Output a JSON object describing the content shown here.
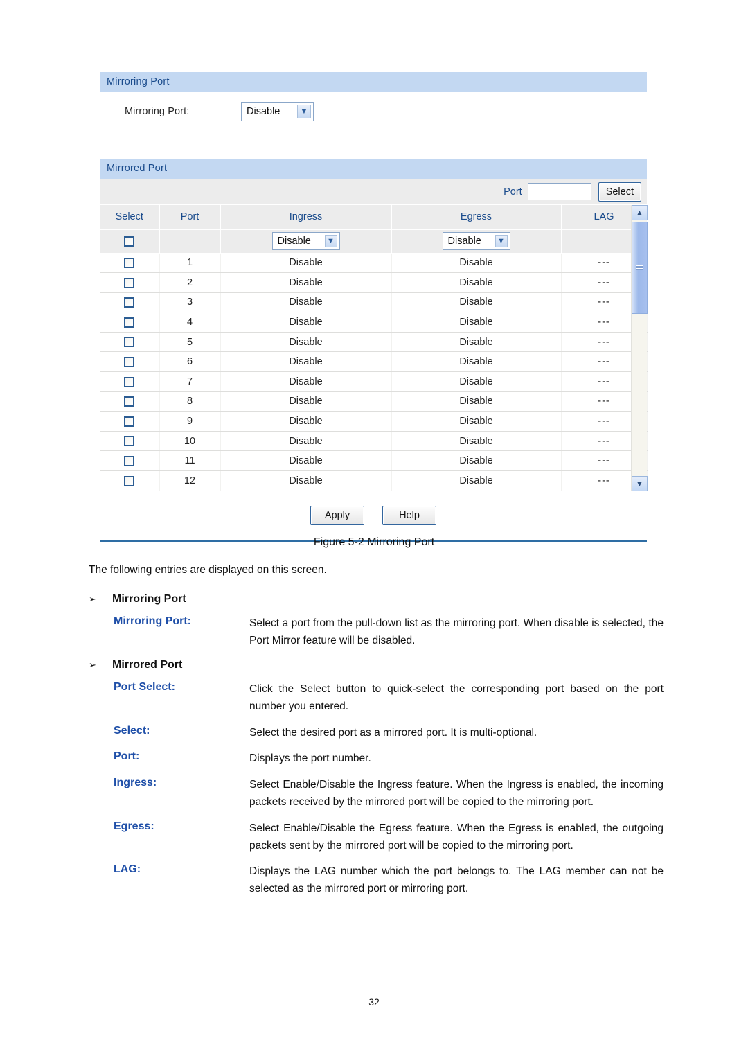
{
  "figure": {
    "mirroring_panel": {
      "title": "Mirroring Port",
      "field_label": "Mirroring Port:",
      "select_value": "Disable"
    },
    "mirrored_panel": {
      "title": "Mirrored Port",
      "port_quickselect": {
        "label": "Port",
        "input_value": "",
        "button_label": "Select"
      },
      "columns": [
        "Select",
        "Port",
        "Ingress",
        "Egress",
        "LAG"
      ],
      "control_row": {
        "ingress_select": "Disable",
        "egress_select": "Disable"
      },
      "rows": [
        {
          "port": "1",
          "ingress": "Disable",
          "egress": "Disable",
          "lag": "---"
        },
        {
          "port": "2",
          "ingress": "Disable",
          "egress": "Disable",
          "lag": "---"
        },
        {
          "port": "3",
          "ingress": "Disable",
          "egress": "Disable",
          "lag": "---"
        },
        {
          "port": "4",
          "ingress": "Disable",
          "egress": "Disable",
          "lag": "---"
        },
        {
          "port": "5",
          "ingress": "Disable",
          "egress": "Disable",
          "lag": "---"
        },
        {
          "port": "6",
          "ingress": "Disable",
          "egress": "Disable",
          "lag": "---"
        },
        {
          "port": "7",
          "ingress": "Disable",
          "egress": "Disable",
          "lag": "---"
        },
        {
          "port": "8",
          "ingress": "Disable",
          "egress": "Disable",
          "lag": "---"
        },
        {
          "port": "9",
          "ingress": "Disable",
          "egress": "Disable",
          "lag": "---"
        },
        {
          "port": "10",
          "ingress": "Disable",
          "egress": "Disable",
          "lag": "---"
        },
        {
          "port": "11",
          "ingress": "Disable",
          "egress": "Disable",
          "lag": "---"
        },
        {
          "port": "12",
          "ingress": "Disable",
          "egress": "Disable",
          "lag": "---"
        }
      ],
      "scrollbar": {
        "up_arrow": "▲",
        "down_arrow": "▼"
      },
      "buttons": {
        "apply": "Apply",
        "help": "Help"
      }
    }
  },
  "caption": "Figure 5-2 Mirroring Port",
  "doc": {
    "intro": "The following entries are displayed on this screen.",
    "arrow_glyph": "➢",
    "sections": [
      {
        "heading": "Mirroring Port",
        "entries": [
          {
            "term": "Mirroring Port:",
            "desc": "Select a port from the pull-down list as the mirroring port. When disable is selected, the Port Mirror feature will be disabled."
          }
        ]
      },
      {
        "heading": "Mirrored Port",
        "entries": [
          {
            "term": "Port Select:",
            "desc": "Click the Select button to quick-select the corresponding port based on the port number you entered."
          },
          {
            "term": "Select:",
            "desc": "Select the desired port as a mirrored port. It is multi-optional."
          },
          {
            "term": "Port:",
            "desc": "Displays the port number."
          },
          {
            "term": "Ingress:",
            "desc": "Select Enable/Disable the Ingress feature. When the Ingress is enabled, the incoming packets received by the mirrored port will be copied to the mirroring port."
          },
          {
            "term": "Egress:",
            "desc": "Select Enable/Disable the Egress feature. When the Egress is enabled, the outgoing packets sent by the mirrored port will be copied to the mirroring port."
          },
          {
            "term": "LAG:",
            "desc": "Displays the LAG number which the port belongs to. The LAG member can not be selected as the mirrored port or mirroring port."
          }
        ]
      }
    ]
  },
  "page_number": "32",
  "colors": {
    "panel_header_bg": "#c3d8f2",
    "panel_header_text": "#1a4b8c",
    "table_header_bg": "#ececec",
    "divider": "#2e6da4",
    "term_text": "#1f4fa8"
  }
}
